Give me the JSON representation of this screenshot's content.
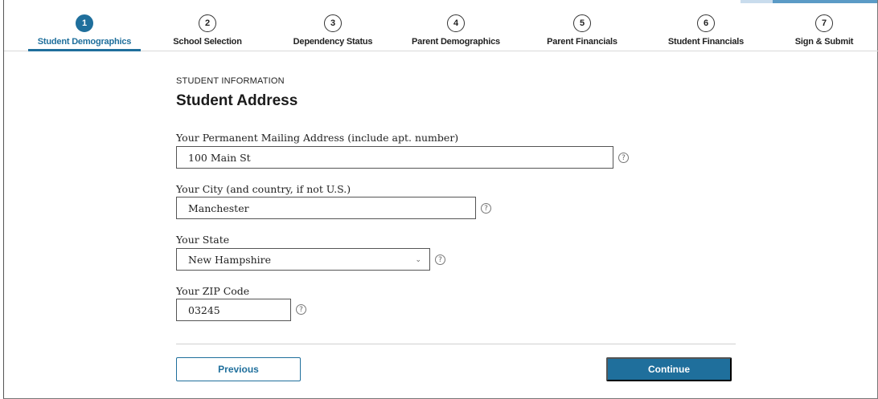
{
  "stepper": {
    "steps": [
      {
        "number": "1",
        "label": "Student Demographics"
      },
      {
        "number": "2",
        "label": "School Selection"
      },
      {
        "number": "3",
        "label": "Dependency Status"
      },
      {
        "number": "4",
        "label": "Parent Demographics"
      },
      {
        "number": "5",
        "label": "Parent Financials"
      },
      {
        "number": "6",
        "label": "Student Financials"
      },
      {
        "number": "7",
        "label": "Sign & Submit"
      }
    ],
    "active_step": "1"
  },
  "section": {
    "kicker": "STUDENT INFORMATION",
    "title": "Student Address"
  },
  "fields": {
    "address": {
      "label": "Your Permanent Mailing Address (include apt. number)",
      "value": "100 Main St"
    },
    "city": {
      "label": "Your City (and country, if not U.S.)",
      "value": "Manchester"
    },
    "state": {
      "label": "Your State",
      "value": "New Hampshire"
    },
    "zip": {
      "label": "Your ZIP Code",
      "value": "03245"
    }
  },
  "help_icon_glyph": "?",
  "actions": {
    "previous_label": "Previous",
    "continue_label": "Continue"
  },
  "colors": {
    "accent": "#1f6f9c"
  }
}
